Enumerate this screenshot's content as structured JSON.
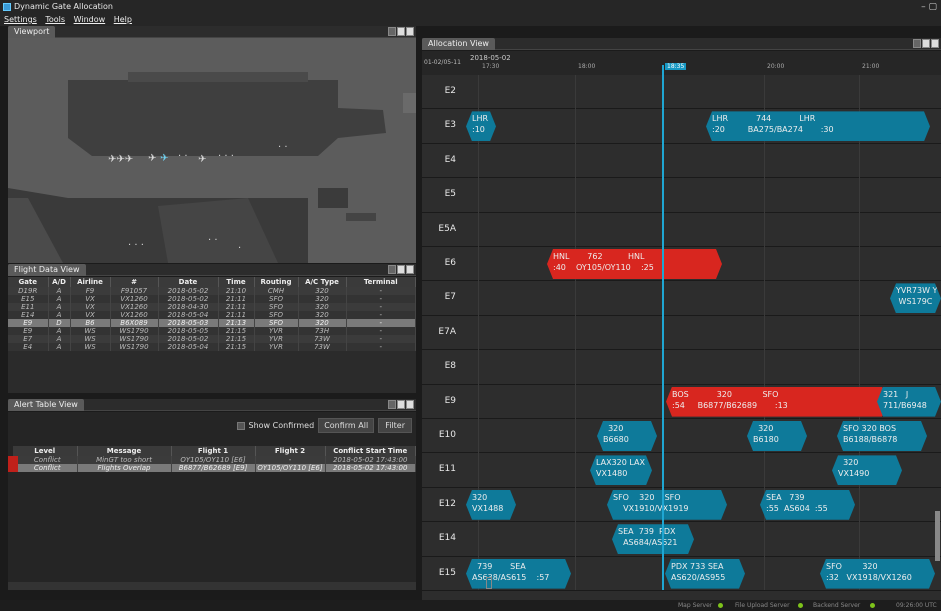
{
  "app": {
    "title": "Dynamic Gate Allocation"
  },
  "menu": [
    "Settings",
    "Tools",
    "Window",
    "Help"
  ],
  "viewport_panel": {
    "tab": "Viewport"
  },
  "flight_panel": {
    "tab": "Flight Data View",
    "columns": [
      "Gate",
      "A/D",
      "Airline",
      "#",
      "Date",
      "Time",
      "Routing",
      "A/C Type",
      "Terminal"
    ],
    "rows": [
      [
        "D19R",
        "A",
        "F9",
        "F91057",
        "2018-05-02",
        "21:10",
        "CMH",
        "320",
        "-"
      ],
      [
        "E15",
        "A",
        "VX",
        "VX1260",
        "2018-05-02",
        "21:11",
        "SFO",
        "320",
        "-"
      ],
      [
        "E11",
        "A",
        "VX",
        "VX1260",
        "2018-04-30",
        "21:11",
        "SFO",
        "320",
        "-"
      ],
      [
        "E14",
        "A",
        "VX",
        "VX1260",
        "2018-05-04",
        "21:11",
        "SFO",
        "320",
        "-"
      ],
      [
        "E9",
        "D",
        "B6",
        "B6X089",
        "2018-05-03",
        "21:13",
        "SFO",
        "320",
        "-"
      ],
      [
        "E9",
        "A",
        "WS",
        "WS1790",
        "2018-05-05",
        "21:15",
        "YVR",
        "73H",
        "-"
      ],
      [
        "E7",
        "A",
        "WS",
        "WS1790",
        "2018-05-02",
        "21:15",
        "YVR",
        "73W",
        "-"
      ],
      [
        "E4",
        "A",
        "WS",
        "WS1790",
        "2018-05-04",
        "21:15",
        "YVR",
        "73W",
        "-"
      ]
    ]
  },
  "alert_panel": {
    "tab": "Alert Table View",
    "show_confirmed": "Show Confirmed",
    "confirm_all": "Confirm All",
    "filter": "Filter",
    "columns": [
      "Level",
      "Message",
      "Flight 1",
      "Flight 2",
      "Conflict Start Time"
    ],
    "rows": [
      [
        "Conflict",
        "MinGT too short",
        "OY105/OY110 [E6]",
        "-",
        "2018-05-02 17:43:00"
      ],
      [
        "Conflict",
        "Flights Overlap",
        "B6877/B62689 [E9]",
        "OY105/OY110 [E6]",
        "2018-05-02 17:43:00"
      ]
    ]
  },
  "alloc_panel": {
    "tab": "Allocation View",
    "date_left": "01-02/05-11",
    "date_top": "2018-05-02",
    "times": [
      "17:30",
      "18:00",
      "18:35",
      "20:00",
      "21:00"
    ],
    "gates": [
      "E2",
      "E3",
      "E4",
      "E5",
      "E5A",
      "E6",
      "E7",
      "E7A",
      "E8",
      "E9",
      "E10",
      "E11",
      "E12",
      "E14",
      "E15"
    ]
  },
  "bars": [
    {
      "text": "LHR\n:10"
    },
    {
      "text": "LHR           744           LHR\n:20         BA275/BA274       :30"
    },
    {
      "text": "HNL       762          HNL\n:40    OY105/OY110    :25"
    },
    {
      "text": "YVR73W Y\n WS179C"
    },
    {
      "text": "BOS           320            SFO\n:54     B6877/B62689       :13"
    },
    {
      "text": "321   J\n711/B6948"
    },
    {
      "text": "  320\nB6680"
    },
    {
      "text": "  320\nB6180"
    },
    {
      "text": "SFO 320 BOS\nB6188/B6878"
    },
    {
      "text": "LAX320 LAX\nVX1480"
    },
    {
      "text": "  320\nVX1490"
    },
    {
      "text": "320\nVX1488"
    },
    {
      "text": "SFO    320    SFO\n    VX1910/VX1919"
    },
    {
      "text": "SEA   739\n:55  AS604  :55"
    },
    {
      "text": "SEA  739  PDX\n  AS684/AS621"
    },
    {
      "text": "  739       SEA\nAS638/AS615    :57"
    },
    {
      "text": "PDX 733 SEA\nAS620/AS955"
    },
    {
      "text": "SFO        320\n:32   VX1918/VX1260"
    }
  ],
  "status": {
    "items": [
      "Map Server",
      "File Upload Server",
      "Backend Server"
    ],
    "clock": "09:26:00 UTC"
  }
}
